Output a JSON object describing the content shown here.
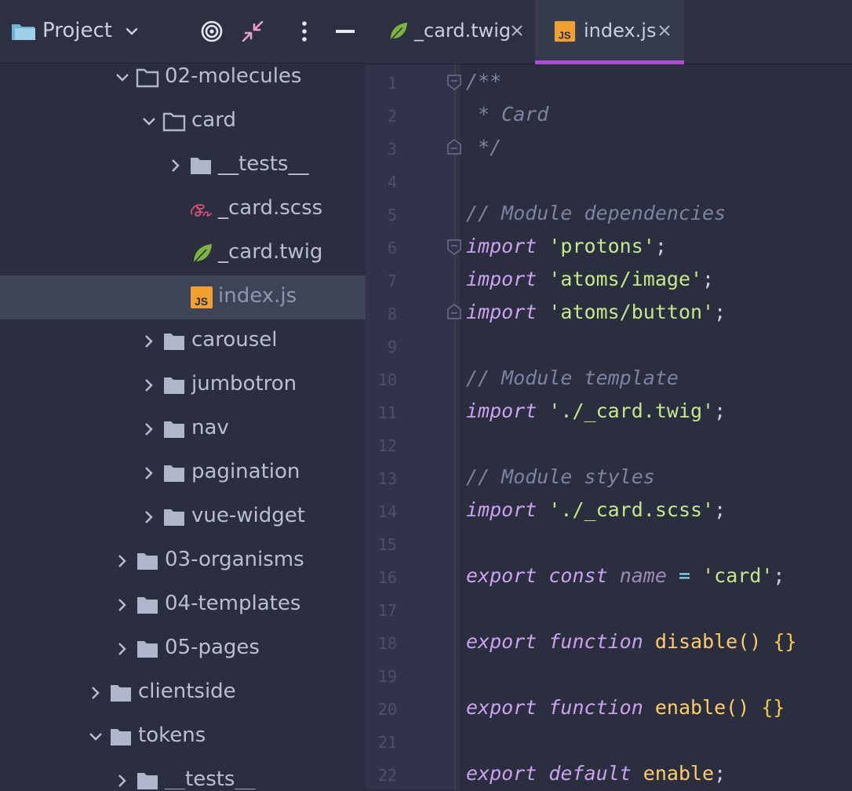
{
  "project_panel": {
    "title": "Project",
    "icons": [
      "folder-icon",
      "chevron-down-icon",
      "locate-target-icon",
      "collapse-all-icon",
      "more-vertical-icon",
      "minimize-icon"
    ]
  },
  "tree": [
    {
      "label": "02-molecules",
      "type": "folder",
      "expanded": true
    },
    {
      "label": "card",
      "type": "folder",
      "expanded": true
    },
    {
      "label": "__tests__",
      "type": "folder",
      "expanded": false
    },
    {
      "label": "_card.scss",
      "type": "file",
      "file_icon": "sass-icon"
    },
    {
      "label": "_card.twig",
      "type": "file",
      "file_icon": "twig-leaf-icon"
    },
    {
      "label": "index.js",
      "type": "file",
      "file_icon": "js-icon",
      "selected": true
    },
    {
      "label": "carousel",
      "type": "folder",
      "expanded": false
    },
    {
      "label": "jumbotron",
      "type": "folder",
      "expanded": false
    },
    {
      "label": "nav",
      "type": "folder",
      "expanded": false
    },
    {
      "label": "pagination",
      "type": "folder",
      "expanded": false
    },
    {
      "label": "vue-widget",
      "type": "folder",
      "expanded": false
    },
    {
      "label": "03-organisms",
      "type": "folder",
      "expanded": false
    },
    {
      "label": "04-templates",
      "type": "folder",
      "expanded": false
    },
    {
      "label": "05-pages",
      "type": "folder",
      "expanded": false
    },
    {
      "label": "clientside",
      "type": "folder",
      "expanded": false
    },
    {
      "label": "tokens",
      "type": "folder",
      "expanded": true
    },
    {
      "label": "__tests__",
      "type": "folder",
      "expanded": false
    }
  ],
  "tabs": [
    {
      "label": "_card.twig",
      "icon": "twig-leaf-icon",
      "active": false
    },
    {
      "label": "index.js",
      "icon": "js-icon",
      "active": true
    }
  ],
  "editor": {
    "lines": [
      {
        "n": "1",
        "tokens": [
          [
            "cm",
            "/**"
          ]
        ]
      },
      {
        "n": "2",
        "tokens": [
          [
            "cm",
            " * Card"
          ]
        ]
      },
      {
        "n": "3",
        "tokens": [
          [
            "cm",
            " */"
          ]
        ]
      },
      {
        "n": "4",
        "tokens": []
      },
      {
        "n": "5",
        "tokens": [
          [
            "cm",
            "// Module dependencies"
          ]
        ]
      },
      {
        "n": "6",
        "tokens": [
          [
            "kw",
            "import"
          ],
          [
            "pl",
            " "
          ],
          [
            "str",
            "'protons'"
          ],
          [
            "pl",
            ";"
          ]
        ]
      },
      {
        "n": "7",
        "tokens": [
          [
            "kw",
            "import"
          ],
          [
            "pl",
            " "
          ],
          [
            "str",
            "'atoms/image'"
          ],
          [
            "pl",
            ";"
          ]
        ]
      },
      {
        "n": "8",
        "tokens": [
          [
            "kw",
            "import"
          ],
          [
            "pl",
            " "
          ],
          [
            "str",
            "'atoms/button'"
          ],
          [
            "pl",
            ";"
          ]
        ]
      },
      {
        "n": "9",
        "tokens": []
      },
      {
        "n": "10",
        "tokens": [
          [
            "cm",
            "// Module template"
          ]
        ]
      },
      {
        "n": "11",
        "tokens": [
          [
            "kw",
            "import"
          ],
          [
            "pl",
            " "
          ],
          [
            "str",
            "'./_card.twig'"
          ],
          [
            "pl",
            ";"
          ]
        ]
      },
      {
        "n": "12",
        "tokens": []
      },
      {
        "n": "13",
        "tokens": [
          [
            "cm",
            "// Module styles"
          ]
        ]
      },
      {
        "n": "14",
        "tokens": [
          [
            "kw",
            "import"
          ],
          [
            "pl",
            " "
          ],
          [
            "str",
            "'./_card.scss'"
          ],
          [
            "pl",
            ";"
          ]
        ]
      },
      {
        "n": "15",
        "tokens": []
      },
      {
        "n": "16",
        "tokens": [
          [
            "kw",
            "export"
          ],
          [
            "pl",
            " "
          ],
          [
            "kw",
            "const"
          ],
          [
            "pl",
            " "
          ],
          [
            "var",
            "name"
          ],
          [
            "pl",
            " "
          ],
          [
            "op",
            "="
          ],
          [
            "pl",
            " "
          ],
          [
            "str",
            "'card'"
          ],
          [
            "pl",
            ";"
          ]
        ]
      },
      {
        "n": "17",
        "tokens": []
      },
      {
        "n": "18",
        "tokens": [
          [
            "kw",
            "export"
          ],
          [
            "pl",
            " "
          ],
          [
            "kw",
            "function"
          ],
          [
            "pl",
            " "
          ],
          [
            "fn",
            "disable"
          ],
          [
            "fn",
            "()"
          ],
          [
            "pl",
            " "
          ],
          [
            "br",
            "{}"
          ]
        ]
      },
      {
        "n": "19",
        "tokens": []
      },
      {
        "n": "20",
        "tokens": [
          [
            "kw",
            "export"
          ],
          [
            "pl",
            " "
          ],
          [
            "kw",
            "function"
          ],
          [
            "pl",
            " "
          ],
          [
            "fn",
            "enable"
          ],
          [
            "fn",
            "()"
          ],
          [
            "pl",
            " "
          ],
          [
            "br",
            "{}"
          ]
        ]
      },
      {
        "n": "21",
        "tokens": []
      },
      {
        "n": "22",
        "tokens": [
          [
            "kw",
            "export"
          ],
          [
            "pl",
            " "
          ],
          [
            "kw",
            "default"
          ],
          [
            "pl",
            " "
          ],
          [
            "fn",
            "enable"
          ],
          [
            "pl",
            ";"
          ]
        ]
      }
    ]
  },
  "colors": {
    "accent_underline": "#b04ad6",
    "comment": "#7c83a3",
    "keyword": "#cda1f1",
    "string": "#c3e88d",
    "function": "#ffcb6b",
    "js_icon": "#f0a030",
    "twig_icon": "#7cb342",
    "sass_icon": "#e0507a"
  }
}
